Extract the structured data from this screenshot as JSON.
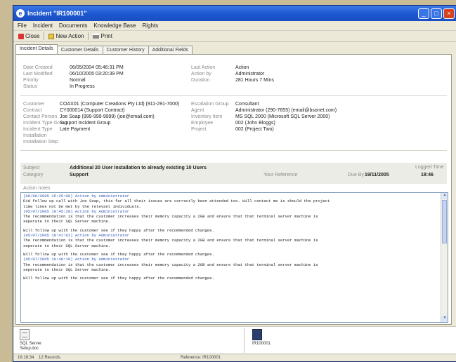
{
  "window": {
    "title": "Incident \"IR100001\""
  },
  "menu": [
    "File",
    "Incident",
    "Documents",
    "Knowledge Base",
    "Rights"
  ],
  "toolbar": {
    "close": "Close",
    "new_action": "New Action",
    "print": "Print"
  },
  "tabs": [
    "Incident Details",
    "Customer Details",
    "Customer History",
    "Additional Fields"
  ],
  "header": {
    "date_created_label": "Date Created",
    "date_created": "06/05/2004 05:46:31 PM",
    "last_modified_label": "Last Modified",
    "last_modified": "06/10/2005 03:20:39 PM",
    "priority_label": "Priority",
    "priority": "Normal",
    "status_label": "Status",
    "status": "In Progress",
    "last_action_label": "Last Action",
    "last_action": "Action",
    "action_by_label": "Action by",
    "action_by": "Administrator",
    "duration_label": "Duration",
    "duration": "281 Hours 7 Mins"
  },
  "details": {
    "customer_label": "Customer",
    "customer": "COAX01 (Computer Creations Pty Ltd) (911-291-7000)",
    "contract_label": "Contract",
    "contract": "CY000014 (Support Contract)",
    "contact_person_label": "Contact Person",
    "contact_person": "Joe Soap (999-999-9999) (joe@email.com)",
    "incident_type_group_label": "Incident Type Group",
    "incident_type_group": "Support Incident Group",
    "incident_type_label": "Incident Type",
    "incident_type": "Late Payment",
    "installation_label": "Installation",
    "installation": "",
    "installation_step_label": "Installation Step",
    "installation_step": "",
    "escalation_group_label": "Escalation Group",
    "escalation_group": "Consultant",
    "agent_label": "Agent",
    "agent": "Administrator (290-7655) (email@bsonet.com)",
    "inventory_item_label": "Inventory Item",
    "inventory_item": "MS SQL 2000 (Microsoft SQL Server 2000)",
    "employee_label": "Employee",
    "employee": "002 (John Bloggs)",
    "project_label": "Project",
    "project": "002 (Project Two)"
  },
  "summary": {
    "subject_label": "Subject",
    "subject": "Additional 20 User Installation to already existing 10 Users",
    "category_label": "Category",
    "category": "Support",
    "your_reference_label": "Your Reference",
    "your_reference": "",
    "due_by_label": "Due By",
    "due_by_date": "19/11/2005",
    "due_by_time": "18:46",
    "logged_label": "Logged Time",
    "logged": ""
  },
  "notes_label": "Action notes",
  "notes": [
    {
      "type": "h",
      "text": "(08/06/2005 15:25:09) Action by Administrator"
    },
    {
      "type": "b",
      "text": "Did follow up call with Joe Soap, this far all their issues are correctly been attended too. Will contact me is should the project"
    },
    {
      "type": "b",
      "text": "time lines not be met by the relevant individuals."
    },
    {
      "type": "h",
      "text": "(05/07/2005 19:45:20) Action by Administrator"
    },
    {
      "type": "b",
      "text": "The recommendation is that the customer increases their memory capacity a 2GB and ensure that that terminal server machine is"
    },
    {
      "type": "b",
      "text": "seperate to their SQL Server machine."
    },
    {
      "type": "gap",
      "text": ""
    },
    {
      "type": "b",
      "text": "Will follow up with the customer see if they happy after the recommended changes."
    },
    {
      "type": "h",
      "text": "(05/07/2005 19:41:01) Action by Administrator"
    },
    {
      "type": "b",
      "text": "The recommendation is that the customer increases their memory capacity a 2GB and ensure that that terminal server machine is"
    },
    {
      "type": "b",
      "text": "seperate to their SQL Server machine."
    },
    {
      "type": "gap",
      "text": ""
    },
    {
      "type": "b",
      "text": "Will follow up with the customer see if they happy after the recommended changes."
    },
    {
      "type": "h",
      "text": "(05/07/2005 19:40:19) Action by Administrator"
    },
    {
      "type": "b",
      "text": "The recommendation is that the customer increases their memory capacity a 2GB and ensure that that terminal server machine is"
    },
    {
      "type": "b",
      "text": "seperate to their SQL Server machine."
    },
    {
      "type": "gap",
      "text": ""
    },
    {
      "type": "b",
      "text": "Will follow up with the customer see if they happy after the recommended changes."
    }
  ],
  "attachments": [
    {
      "name_line1": "SQL Server",
      "name_line2": "Setup.doc",
      "icon": "document-icon"
    },
    {
      "name_line1": "IR100001",
      "name_line2": "",
      "icon": "file-icon"
    }
  ],
  "status_bar": {
    "time": "16:18:34",
    "records": "12 Records",
    "reference": "Reference: IR100001"
  }
}
